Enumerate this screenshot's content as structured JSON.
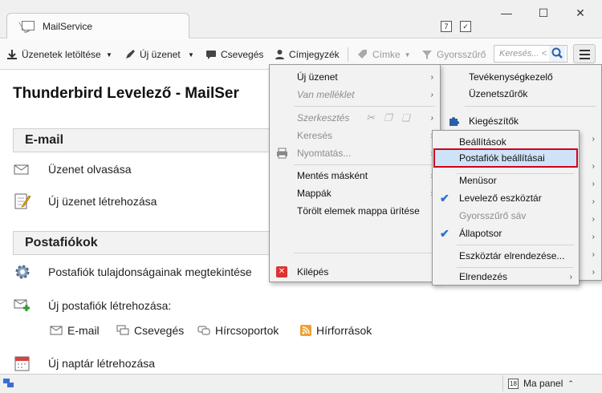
{
  "window": {
    "tab_label": "MailService",
    "minimize": "—",
    "maximize": "☐",
    "close": "✕",
    "calendar_day": "7"
  },
  "toolbar": {
    "get_messages": "Üzenetek letöltése",
    "write": "Új üzenet",
    "chat": "Csevegés",
    "address_book": "Címjegyzék",
    "tag": "Címke",
    "quick_filter": "Gyorsszűrő",
    "search_placeholder": "Keresés... <"
  },
  "main": {
    "title": "Thunderbird Levelező - MailSer",
    "email_section": "E-mail",
    "read_messages": "Üzenet olvasása",
    "write_message": "Új üzenet létrehozása",
    "accounts_section": "Postafiókok",
    "view_settings": "Postafiók tulajdonságainak megtekintése",
    "create_account": "Új postafiók létrehozása:",
    "sub": {
      "email": "E-mail",
      "chat": "Csevegés",
      "newsgroups": "Hírcsoportok",
      "feeds": "Hírforrások"
    },
    "create_calendar": "Új naptár létrehozása"
  },
  "statusbar": {
    "today_pane": "Ma panel",
    "today_day": "18"
  },
  "main_menu": {
    "new_message": "Új üzenet",
    "attachments": "Van melléklet",
    "edit": "Szerkesztés",
    "find": "Keresés",
    "print": "Nyomtatás...",
    "save_as": "Mentés másként",
    "folders": "Mappák",
    "empty_trash": "Törölt elemek mappa ürítése",
    "exit": "Kilépés"
  },
  "right_menu": {
    "activity_manager": "Tevékenységkezelő",
    "message_filters": "Üzenetszűrők",
    "addons": "Kiegészítők"
  },
  "options_menu": {
    "settings": "Beállítások",
    "account_settings": "Postafiók beállításai",
    "menubar": "Menüsor",
    "mail_toolbar": "Levelező eszköztár",
    "quick_filter_bar": "Gyorsszűrő sáv",
    "status_bar": "Állapotsor",
    "customize_toolbar": "Eszköztár elrendezése...",
    "layout": "Elrendezés"
  },
  "colors": {
    "highlight_border": "#d0021b",
    "check_blue": "#2f6fcc"
  }
}
